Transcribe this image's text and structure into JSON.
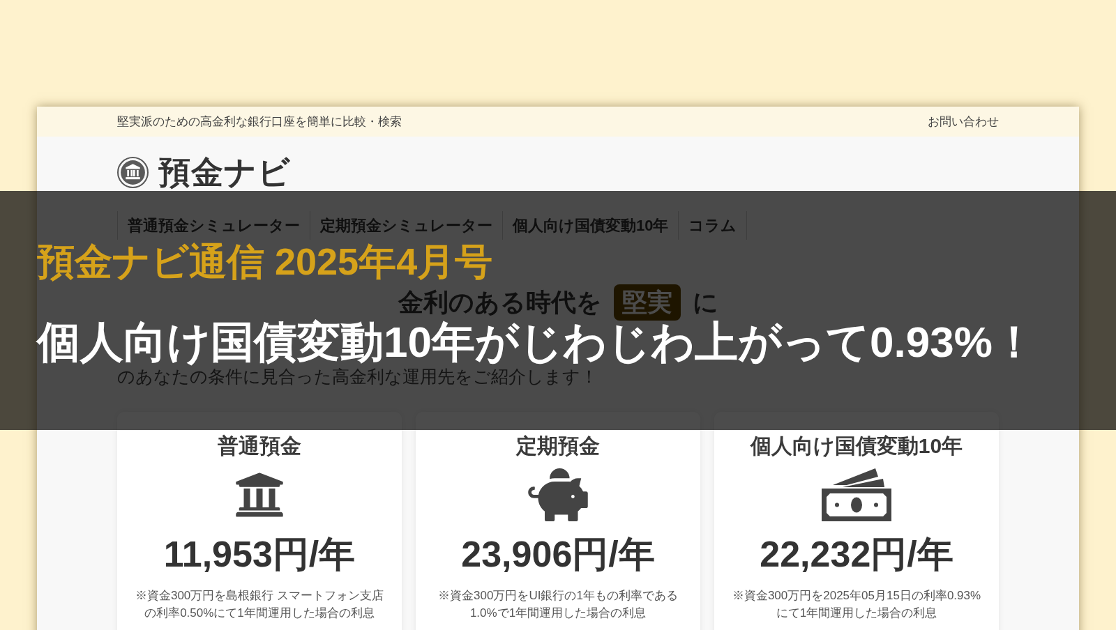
{
  "site": {
    "top_bar": {
      "tagline": "堅実派のための高金利な銀行口座を簡単に比較・検索",
      "contact_link": "お問い合わせ"
    },
    "logo": "預金ナビ",
    "nav": [
      "普通預金シミュレーター",
      "定期預金シミュレーター",
      "個人向け国債変動10年",
      "コラム"
    ],
    "hero": {
      "heading": "金利のある時代を",
      "highlight": "堅実",
      "heading_end": "に",
      "intro": "のあなたの条件に見合った高金利な運用先をご紹介します！"
    },
    "cards": [
      {
        "kind": "bank",
        "title": "普通預金",
        "amount": "11,953円/年",
        "note": "※資金300万円を島根銀行 スマートフォン支店の利率0.50%にて1年間運用した場合の利息"
      },
      {
        "kind": "piggy",
        "title": "定期預金",
        "amount": "23,906円/年",
        "note": "※資金300万円をUI銀行の1年もの利率である1.0%で1年間運用した場合の利息"
      },
      {
        "kind": "bills",
        "title": "個人向け国債変動10年",
        "amount": "22,232円/年",
        "note": "※資金300万円を2025年05月15日の利率0.93%にて1年間運用した場合の利息"
      }
    ]
  },
  "banner": {
    "issue_title": "預金ナビ通信 2025年4月号",
    "headline": "個人向け国債変動10年がじわじわ上がって0.93%！"
  }
}
